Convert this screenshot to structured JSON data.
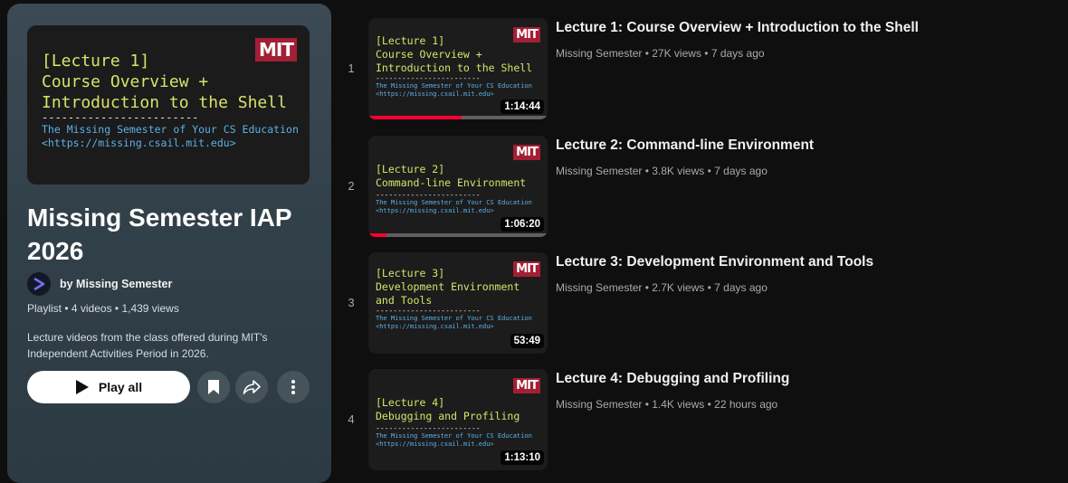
{
  "playlist": {
    "hero": {
      "lecture_line": "[Lecture 1]",
      "title_line1": "Course Overview +",
      "title_line2": "Introduction to the Shell",
      "dashes": "------------------------",
      "byline1": "The Missing Semester of Your CS Education",
      "byline2": "<https://missing.csail.mit.edu>",
      "logo": "MIT"
    },
    "title": "Missing Semester IAP 2026",
    "owner": "by Missing Semester",
    "meta": "Playlist • 4 videos • 1,439 views",
    "description": "Lecture videos from the class offered during MIT's Independent Activities Period in 2026.",
    "play_all_label": "Play all",
    "icons": [
      "play-icon",
      "bookmark-icon",
      "share-icon",
      "more-vertical-icon"
    ]
  },
  "videos": [
    {
      "index": "1",
      "title": "Lecture 1: Course Overview + Introduction to the Shell",
      "channel": "Missing Semester",
      "views": "27K views",
      "age": "7 days ago",
      "duration": "1:14:44",
      "progress": 0.52,
      "thumb_lines": [
        "[Lecture 1]",
        "Course Overview +",
        "Introduction to the Shell"
      ],
      "thumb_dashes": "------------------------",
      "thumb_by1": "The Missing Semester of Your CS Education",
      "thumb_by2": "<https://missing.csail.mit.edu>"
    },
    {
      "index": "2",
      "title": "Lecture 2: Command-line Environment",
      "channel": "Missing Semester",
      "views": "3.8K views",
      "age": "7 days ago",
      "duration": "1:06:20",
      "progress": 0.1,
      "thumb_lines": [
        "[Lecture 2]",
        "Command-line Environment"
      ],
      "thumb_dashes": "------------------------",
      "thumb_by1": "The Missing Semester of Your CS Education",
      "thumb_by2": "<https://missing.csail.mit.edu>"
    },
    {
      "index": "3",
      "title": "Lecture 3: Development Environment and Tools",
      "channel": "Missing Semester",
      "views": "2.7K views",
      "age": "7 days ago",
      "duration": "53:49",
      "progress": 0,
      "thumb_lines": [
        "[Lecture 3]",
        "Development Environment",
        "and Tools"
      ],
      "thumb_dashes": "------------------------",
      "thumb_by1": "The Missing Semester of Your CS Education",
      "thumb_by2": "<https://missing.csail.mit.edu>"
    },
    {
      "index": "4",
      "title": "Lecture 4: Debugging and Profiling",
      "channel": "Missing Semester",
      "views": "1.4K views",
      "age": "22 hours ago",
      "duration": "1:13:10",
      "progress": 0,
      "thumb_lines": [
        "[Lecture 4]",
        "Debugging and Profiling"
      ],
      "thumb_dashes": "------------------------",
      "thumb_by1": "The Missing Semester of Your CS Education",
      "thumb_by2": "<https://missing.csail.mit.edu>"
    }
  ],
  "colors": {
    "accent": "#ff0033",
    "mit": "#a31f34",
    "code_yellow": "#d7e36a",
    "code_blue": "#5ab2e6"
  }
}
